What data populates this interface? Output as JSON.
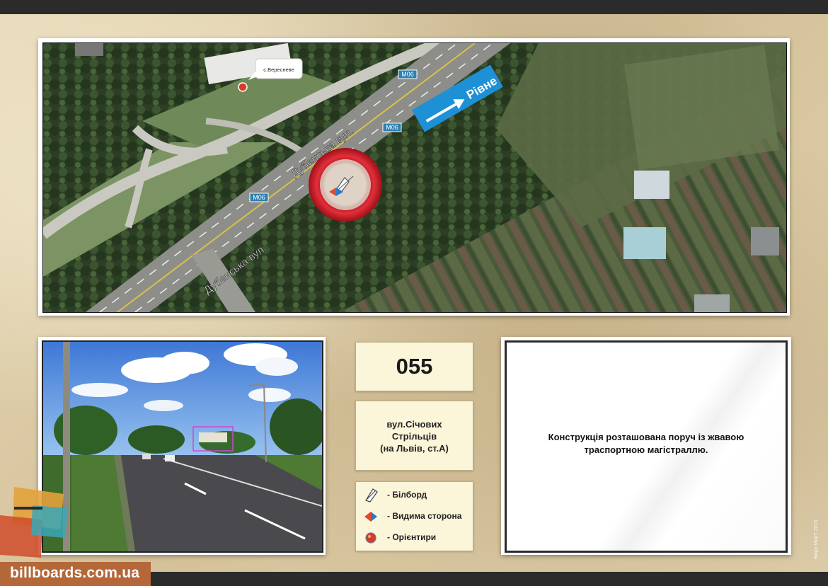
{
  "map": {
    "village_label": "с.Вересневе",
    "road_label_top": "Дубенська вул.",
    "road_label_bottom": "Дубенська вул.",
    "highway_labels": [
      "М06",
      "М06",
      "М06"
    ],
    "direction_label": "Рівне",
    "colors": {
      "direction_arrow": "#1e90d6",
      "target_ring": "#d1202a",
      "marker": "#d83a2a"
    }
  },
  "board": {
    "code": "055",
    "address": [
      "вул.Січових",
      "Стрільців",
      "(на Львів, ст.А)"
    ]
  },
  "legend": {
    "items": [
      {
        "icon": "billboard-icon",
        "label": "- Білборд"
      },
      {
        "icon": "visible-side-icon",
        "label": "- Видима сторона"
      },
      {
        "icon": "landmark-icon",
        "label": "- Орієнтири"
      }
    ]
  },
  "description": {
    "lines": [
      "Конструкція розташована поруч із жвавою",
      "траспортною магістраллю."
    ]
  },
  "footer": {
    "logo_text": "billboards.com.ua",
    "credit": "Бюро МарТ 2013",
    "colors": {
      "logo_bg": "#b4683a",
      "bars": "#2b2b2b"
    }
  }
}
